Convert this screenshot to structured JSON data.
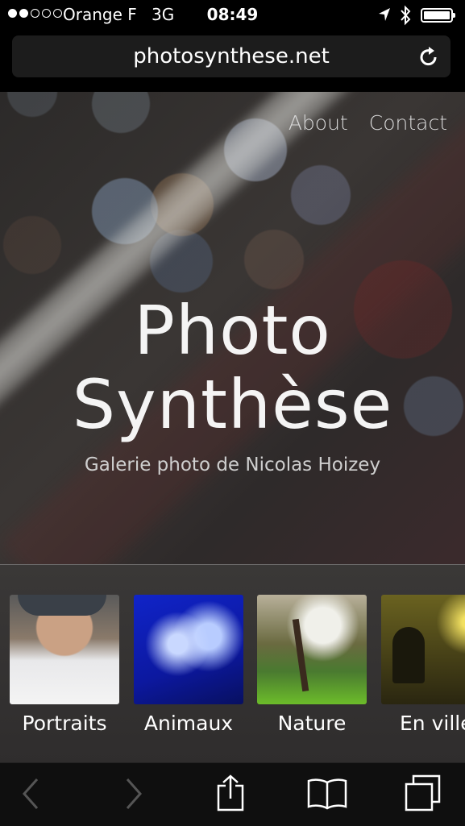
{
  "status_bar": {
    "signal_dots": [
      true,
      true,
      false,
      false,
      false
    ],
    "carrier": "Orange F",
    "network": "3G",
    "time": "08:49",
    "icons": [
      "location-arrow-icon",
      "bluetooth-icon",
      "battery-icon"
    ]
  },
  "browser": {
    "url": "photosynthese.net",
    "reload_icon": "reload-icon"
  },
  "site": {
    "nav": [
      {
        "label": "About"
      },
      {
        "label": "Contact"
      }
    ],
    "title_line1": "Photo",
    "title_line2": "Synthèse",
    "subtitle": "Galerie photo de Nicolas Hoizey"
  },
  "gallery": [
    {
      "label": "Portraits"
    },
    {
      "label": "Animaux"
    },
    {
      "label": "Nature"
    },
    {
      "label": "En ville"
    }
  ],
  "toolbar": {
    "icons": [
      "back-icon",
      "forward-icon",
      "share-icon",
      "bookmarks-icon",
      "tabs-icon"
    ]
  }
}
